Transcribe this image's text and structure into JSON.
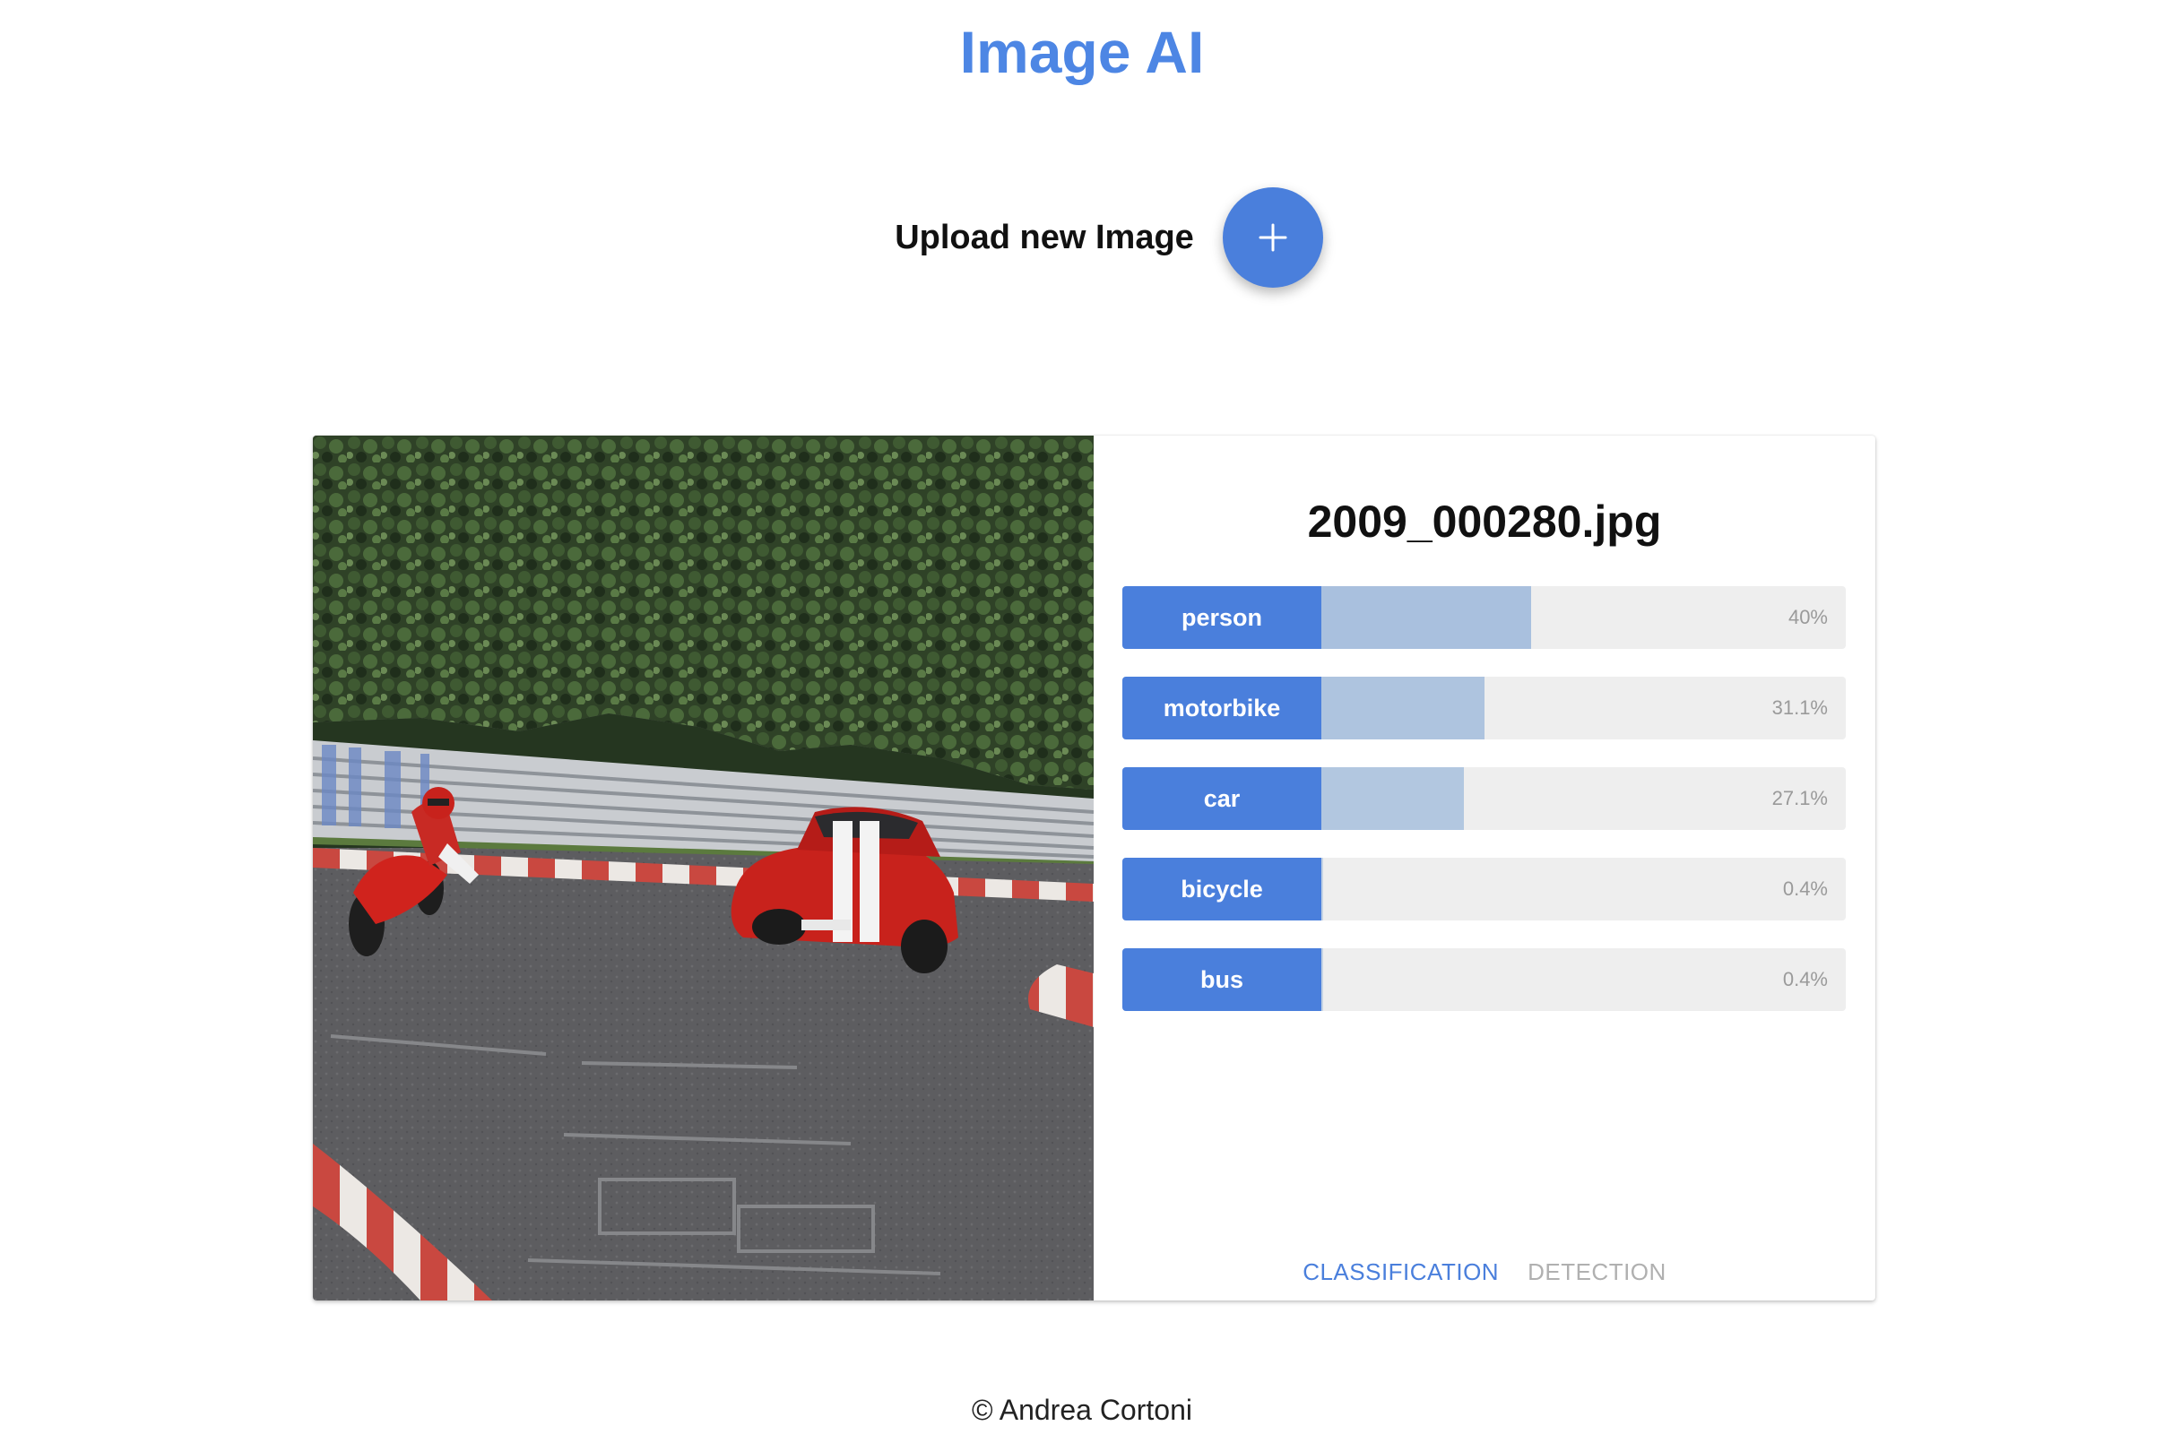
{
  "colors": {
    "accent": "#4a7fdc",
    "title": "#4d86e4",
    "bar_track": "#eeeeee",
    "tab_inactive": "#b0b0b0"
  },
  "app": {
    "title": "Image AI"
  },
  "upload": {
    "label": "Upload new Image",
    "button_icon": "plus-icon"
  },
  "result": {
    "file_name": "2009_000280.jpg",
    "photo_icon": "race-track-photo",
    "predictions": [
      {
        "label": "person",
        "value": "40%",
        "fraction": 0.4
      },
      {
        "label": "motorbike",
        "value": "31.1%",
        "fraction": 0.311
      },
      {
        "label": "car",
        "value": "27.1%",
        "fraction": 0.271
      },
      {
        "label": "bicycle",
        "value": "0.4%",
        "fraction": 0.004
      },
      {
        "label": "bus",
        "value": "0.4%",
        "fraction": 0.004
      }
    ],
    "tabs": [
      {
        "label": "CLASSIFICATION",
        "active": true
      },
      {
        "label": "DETECTION",
        "active": false
      }
    ]
  },
  "footer": {
    "text": "© Andrea Cortoni"
  }
}
